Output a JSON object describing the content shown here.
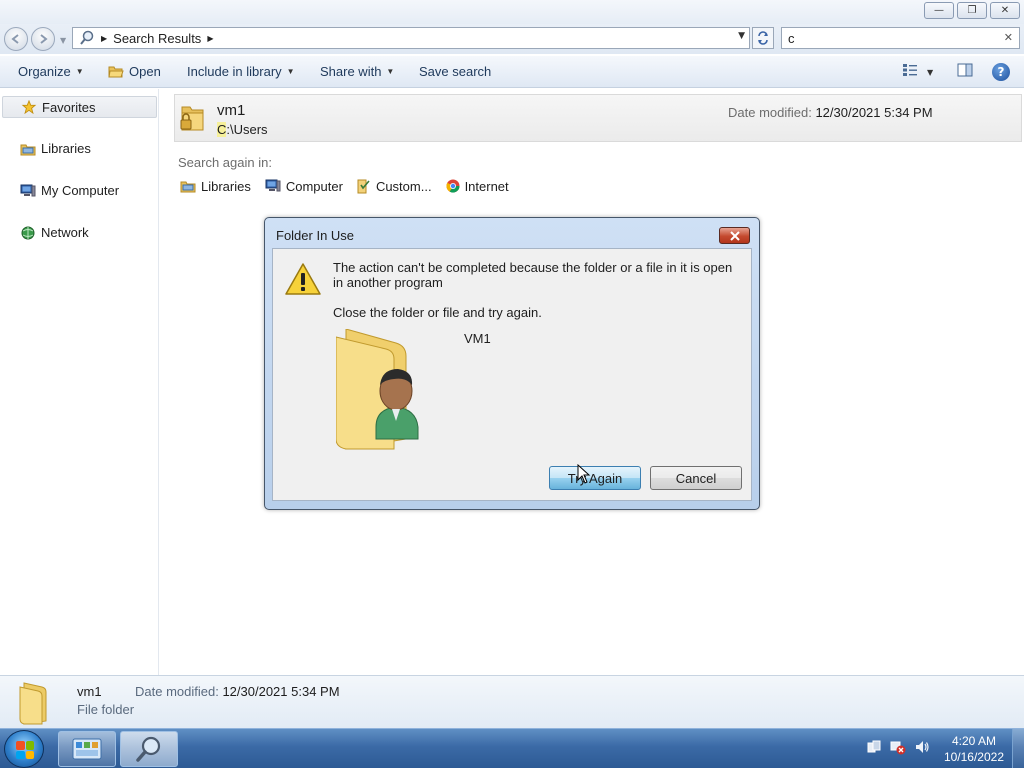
{
  "window": {
    "minimize_glyph": "—",
    "maximize_glyph": "❐",
    "close_glyph": "✕"
  },
  "address": {
    "breadcrumb": "Search Results",
    "search_value": "c"
  },
  "toolbar": {
    "organize": "Organize",
    "open": "Open",
    "include_in_library": "Include in library",
    "share_with": "Share with",
    "save_search": "Save search",
    "help": "?"
  },
  "nav": {
    "favorites": "Favorites",
    "libraries": "Libraries",
    "my_computer": "My Computer",
    "network": "Network"
  },
  "result": {
    "name": "vm1",
    "path_highlight": "C",
    "path_rest": ":\\Users",
    "date_label": "Date modified:",
    "date_value": "12/30/2021 5:34 PM"
  },
  "search_again": {
    "label": "Search again in:",
    "items": [
      "Libraries",
      "Computer",
      "Custom...",
      "Internet"
    ]
  },
  "dialog": {
    "title": "Folder In Use",
    "message": "The action can't be completed because the folder or a file in it is open in another program",
    "instruction": "Close the folder or file and try again.",
    "folder_name": "VM1",
    "try_again": "Try Again",
    "cancel": "Cancel"
  },
  "details": {
    "name": "vm1",
    "date_label": "Date modified:",
    "date_value": "12/30/2021 5:34 PM",
    "type": "File folder"
  },
  "taskbar": {
    "time": "4:20 AM",
    "date": "10/16/2022"
  },
  "icons": {
    "folder": "folder-icon",
    "warning": "warning-icon",
    "search": "search-icon"
  },
  "colors": {
    "taskbar": "#3b6aa6",
    "dialog_frame": "#b8cfeb",
    "highlight": "#f6f09a",
    "close_red": "#c44a2f"
  }
}
